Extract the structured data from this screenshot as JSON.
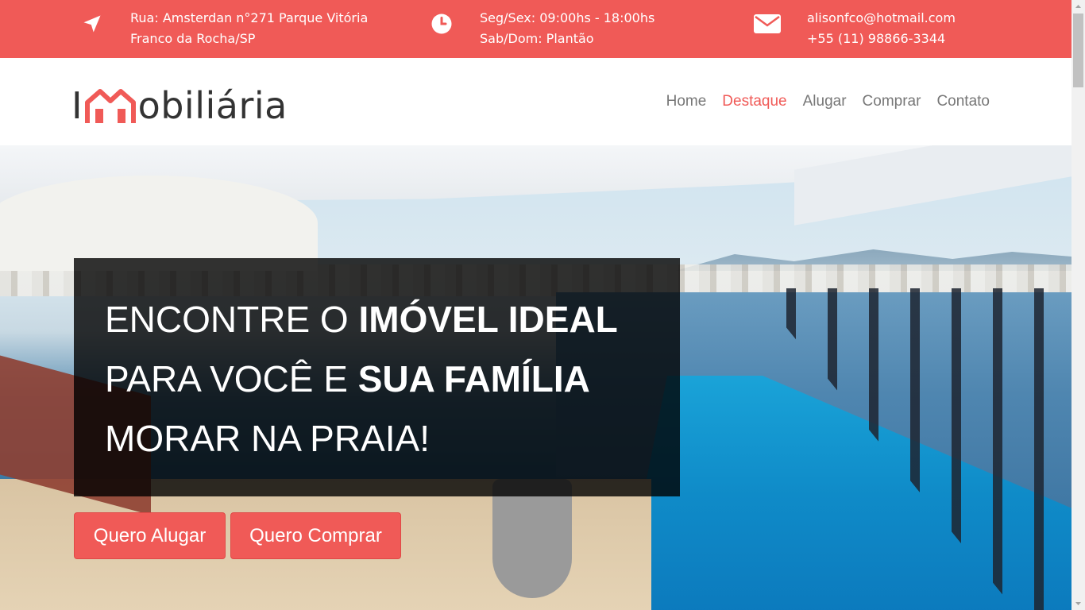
{
  "topbar": {
    "address_line1": "Rua: Amsterdan n°271 Parque Vitória",
    "address_line2": "Franco da Rocha/SP",
    "hours_line1": "Seg/Sex: 09:00hs - 18:00hs",
    "hours_line2": "Sab/Dom: Plantão",
    "email": "alisonfco@hotmail.com",
    "phone": "+55 (11) 98866-3344",
    "icons": [
      "location-arrow-icon",
      "clock-icon",
      "envelope-icon"
    ],
    "bg_color": "#f05a57"
  },
  "logo": {
    "prefix": "I",
    "suffix": "obiliária",
    "accent_color": "#f05a57"
  },
  "nav": {
    "items": [
      "Home",
      "Destaque",
      "Alugar",
      "Comprar",
      "Contato"
    ],
    "active": "Destaque"
  },
  "hero": {
    "line1_light": "ENCONTRE O ",
    "line1_bold": "IMÓVEL IDEAL",
    "line2_light": "PARA VOCÊ E ",
    "line2_bold": "SUA FAMÍLIA",
    "line3_light": "MORAR NA PRAIA!",
    "btn_rent": "Quero Alugar",
    "btn_buy": "Quero Comprar"
  }
}
